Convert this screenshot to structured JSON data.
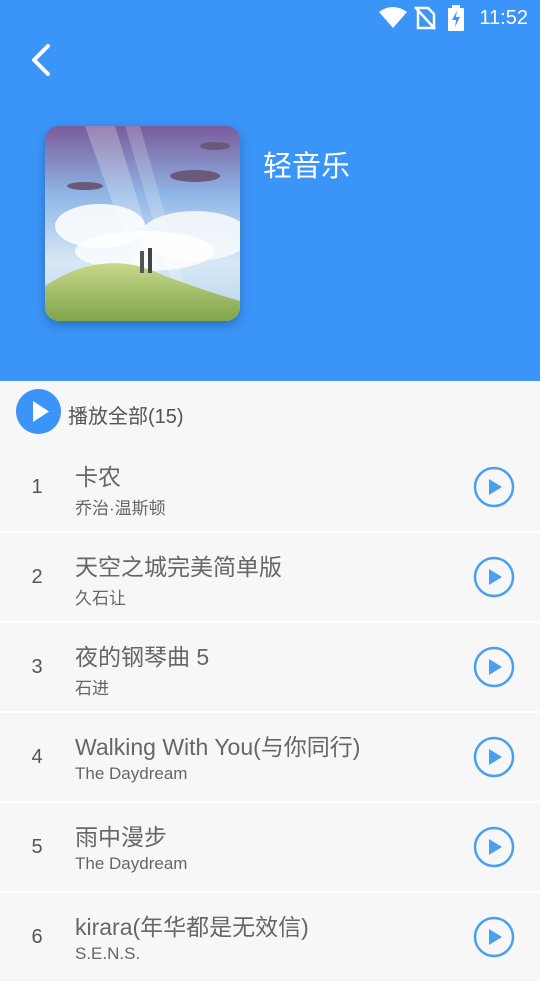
{
  "status_bar": {
    "time": "11:52"
  },
  "header": {
    "background_color": "#3b94f7",
    "back_icon": "chevron-left-icon",
    "playlist_title": "轻音乐"
  },
  "play_all": {
    "label": "播放全部(15)",
    "icon": "play-circle-icon"
  },
  "songs": [
    {
      "index": "1",
      "title": "卡农",
      "artist": "乔治·温斯顿"
    },
    {
      "index": "2",
      "title": "天空之城完美简单版",
      "artist": "久石让"
    },
    {
      "index": "3",
      "title": "夜的钢琴曲 5",
      "artist": "石进"
    },
    {
      "index": "4",
      "title": "Walking With You(与你同行)",
      "artist": "The Daydream"
    },
    {
      "index": "5",
      "title": "雨中漫步",
      "artist": "The Daydream"
    },
    {
      "index": "6",
      "title": "kirara(年华都是无效信)",
      "artist": "S.E.N.S."
    }
  ]
}
